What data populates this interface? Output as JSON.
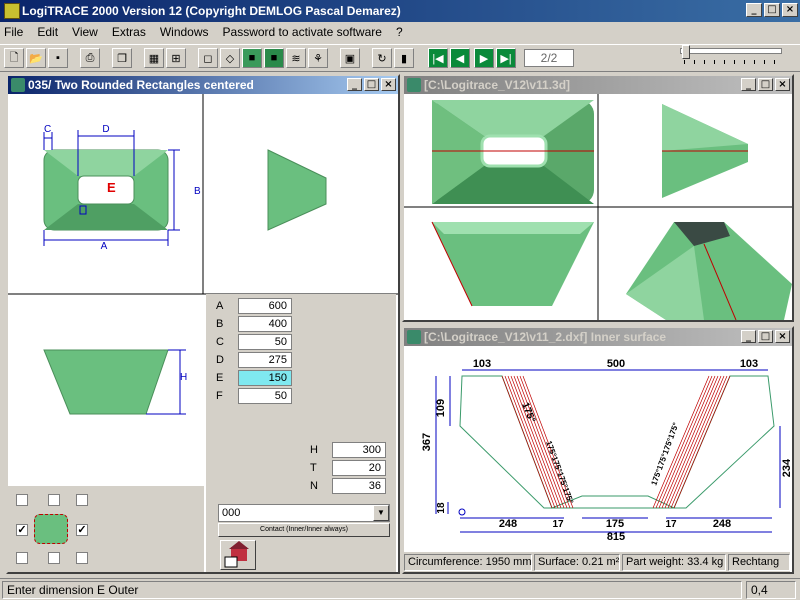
{
  "app": {
    "title": "LogiTRACE 2000  Version 12  (Copyright DEMLOG Pascal Demarez)"
  },
  "menu": [
    "File",
    "Edit",
    "View",
    "Extras",
    "Windows",
    "Password to activate software",
    "?"
  ],
  "toolbar": {
    "page_indicator": "2/2"
  },
  "window_main": {
    "title": "035/ Two Rounded Rectangles centered"
  },
  "window_3d": {
    "title": "[C:\\Logitrace_V12\\v11.3d]"
  },
  "window_dxf": {
    "title": "[C:\\Logitrace_V12\\v11_2.dxf]  Inner surface"
  },
  "top_view_labels": {
    "a": "A",
    "b": "B",
    "c": "C",
    "d": "D",
    "e": "E"
  },
  "side_view_label": "H",
  "parameters": [
    {
      "label": "A",
      "value": "600"
    },
    {
      "label": "B",
      "value": "400"
    },
    {
      "label": "C",
      "value": "50"
    },
    {
      "label": "D",
      "value": "275"
    },
    {
      "label": "E",
      "value": "150",
      "selected": true
    },
    {
      "label": "F",
      "value": "50"
    }
  ],
  "parameters2": [
    {
      "label": "H",
      "value": "300"
    },
    {
      "label": "T",
      "value": "20"
    },
    {
      "label": "N",
      "value": "36"
    }
  ],
  "combo": {
    "value": "000",
    "button_label": "Contact (Inner/Inner always)"
  },
  "dxf_dims": {
    "top_left": "103",
    "top_mid": "500",
    "top_right": "103",
    "angle_top": "175°",
    "left_v1": "109",
    "left_v2": "367",
    "left_v3": "18",
    "right_v": "234",
    "bot_1": "248",
    "bot_2": "17",
    "bot_3": "175",
    "bot_4": "17",
    "bot_5": "248",
    "bot_total": "815",
    "angles_left": "175°175°175°175°",
    "angles_right": "175°175°175°175°"
  },
  "info": {
    "circumference": "Circumference: 1950 mm",
    "surface": "Surface: 0.21 m²",
    "weight": "Part weight: 33.4 kg",
    "shape": "Rechtang"
  },
  "status": {
    "message": "Enter dimension E Outer",
    "value": "0,4"
  },
  "colors": {
    "part_green": "#6abf7f",
    "dim_blue": "#0000c0",
    "highlight_cyan": "#7fe8f0"
  }
}
